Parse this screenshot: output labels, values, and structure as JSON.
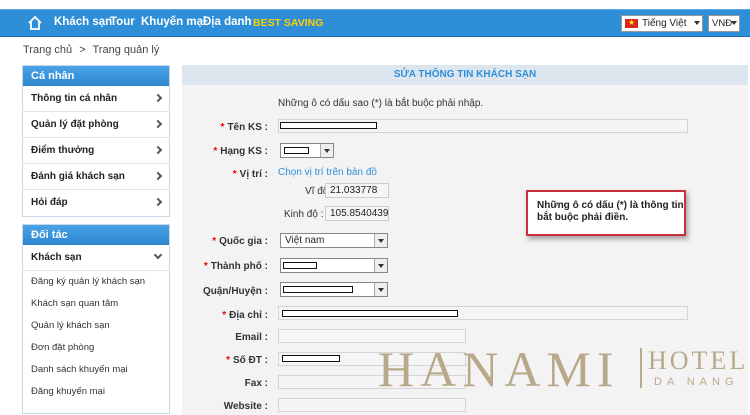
{
  "nav": {
    "links": [
      "Khách sạn",
      "Tour",
      "Khuyến mại",
      "Địa danh"
    ],
    "best_saving": "BEST SAVING",
    "language": "Tiếng Việt",
    "currency": "VNĐ"
  },
  "breadcrumb": {
    "home": "Trang chủ",
    "sep": ">",
    "current": "Trang quản lý"
  },
  "sidebar": {
    "personal_title": "Cá nhân",
    "personal_items": [
      "Thông tin cá nhân",
      "Quản lý đặt phòng",
      "Điểm thưởng",
      "Đánh giá khách sạn",
      "Hỏi đáp"
    ],
    "partner_title": "Đối tác",
    "partner_group": "Khách sạn",
    "partner_items": [
      "Đăng ký quản lý khách sạn",
      "Khách sạn quan tâm",
      "Quản lý khách sạn",
      "Đơn đặt phòng",
      "Danh sách khuyến mại",
      "Đăng khuyến mại"
    ]
  },
  "form": {
    "heading": "SỬA THÔNG TIN KHÁCH SẠN",
    "note": "Những ô có dấu sao (*) là bắt buộc phải nhập.",
    "required_mark": "*",
    "labels": {
      "name": "Tên KS :",
      "rank": "Hạng KS :",
      "location": "Vị trí :",
      "country": "Quốc gia :",
      "city": "Thành phố :",
      "district": "Quận/Huyện :",
      "address": "Địa chỉ :",
      "email": "Email :",
      "phone": "Số ĐT :",
      "fax": "Fax :",
      "website": "Website :"
    },
    "map_link": "Chọn vị trí trên bản đồ",
    "lat_label": "Vĩ độ :",
    "lat_value": "21.033778",
    "lng_label": "Kinh độ :",
    "lng_value": "105.8540439",
    "country_value": "Việt nam"
  },
  "callout": "Những ô có dấu (*) là thông tin bắt buộc phải điền.",
  "logo": {
    "main": "HANAMI",
    "hotel": "HOTEL",
    "city": "DA NANG"
  }
}
